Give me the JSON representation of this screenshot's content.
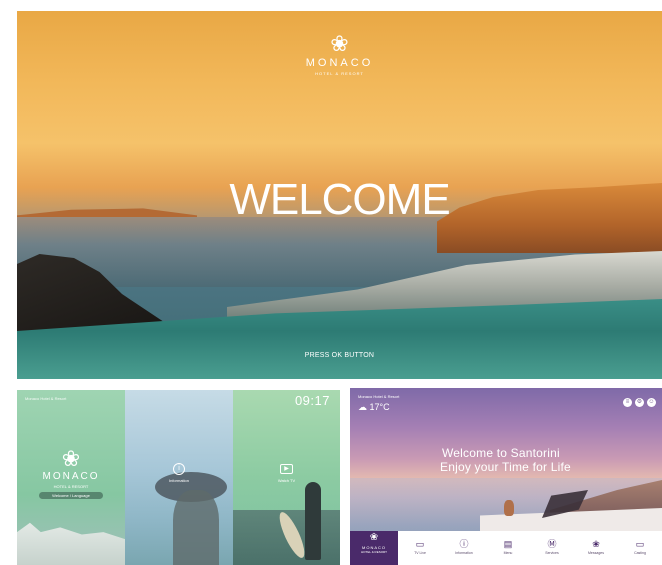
{
  "welcome_screen": {
    "logo": {
      "icon": "lotus-logo-icon",
      "glyph": "❀",
      "brand": "MONACO",
      "subtitle": "HOTEL & RESORT"
    },
    "title": "WELCOME",
    "prompt": "PRESS OK BUTTON"
  },
  "menu_screen": {
    "status": "Monaco Hotel & Resort",
    "clock": "09:17",
    "logo": {
      "icon": "lotus-logo-icon",
      "glyph": "❀",
      "brand": "MONACO",
      "subtitle": "HOTEL & RESORT"
    },
    "language_pill": "Welcome / Language",
    "tiles": [
      {
        "icon": "info-icon",
        "glyph": "i",
        "label": "Information"
      },
      {
        "icon": "play-icon",
        "glyph": "▶",
        "label": "Watch TV"
      }
    ]
  },
  "santorini_screen": {
    "status": "Monaco Hotel & Resort",
    "weather": {
      "icon": "cloud-icon",
      "glyph": "☁",
      "temperature": "17°C"
    },
    "top_icons": [
      {
        "icon": "language-icon",
        "glyph": "≡"
      },
      {
        "icon": "settings-icon",
        "glyph": "⚙"
      },
      {
        "icon": "user-icon",
        "glyph": "☺"
      }
    ],
    "heading": "Welcome to Santorini",
    "subheading": "Enjoy your Time for Life",
    "logo": {
      "icon": "lotus-logo-icon",
      "glyph": "❀",
      "brand": "MONACO",
      "subtitle": "HOTEL & RESORT"
    },
    "nav": [
      {
        "icon": "tv-icon",
        "glyph": "▭",
        "label": "TV Live"
      },
      {
        "icon": "info-icon",
        "glyph": "ⓘ",
        "label": "Information"
      },
      {
        "icon": "document-icon",
        "glyph": "▤",
        "label": "Menu"
      },
      {
        "icon": "service-icon",
        "glyph": "Ⓜ",
        "label": "Services"
      },
      {
        "icon": "chat-icon",
        "glyph": "❀",
        "label": "Messages"
      },
      {
        "icon": "screen-icon",
        "glyph": "▭",
        "label": "Casting"
      }
    ]
  },
  "colors": {
    "brand_purple": "#4a2a6a",
    "welcome_sky": "#f2b85a",
    "menu_green": "#8cc2a8"
  }
}
